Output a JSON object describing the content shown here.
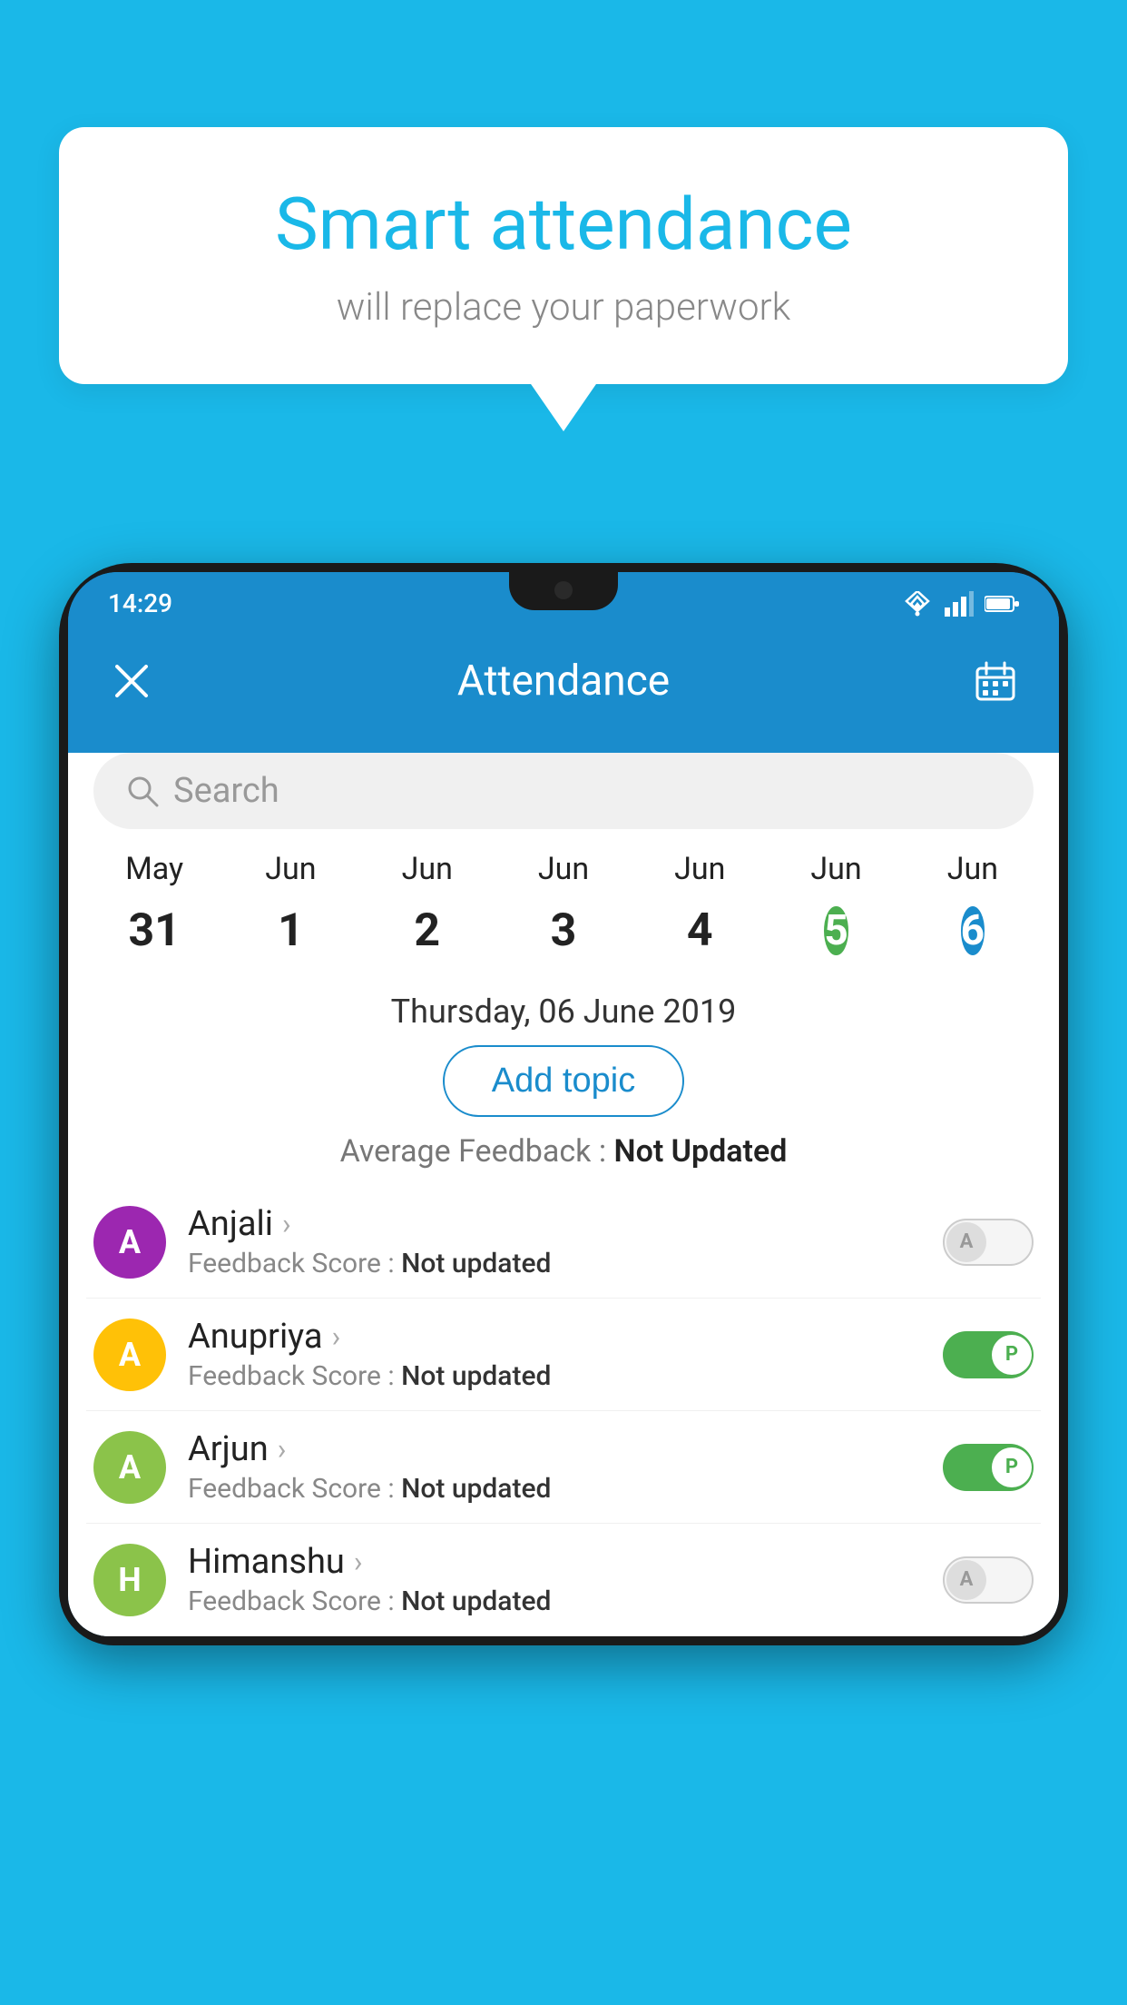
{
  "background_color": "#1ab8e8",
  "speech_bubble": {
    "title": "Smart attendance",
    "subtitle": "will replace your paperwork"
  },
  "status_bar": {
    "time": "14:29",
    "icons": [
      "wifi",
      "signal",
      "battery"
    ]
  },
  "app_header": {
    "title": "Attendance",
    "close_icon": "×",
    "calendar_icon": "📅"
  },
  "search": {
    "placeholder": "Search"
  },
  "calendar": {
    "months": [
      "May",
      "Jun",
      "Jun",
      "Jun",
      "Jun",
      "Jun",
      "Jun"
    ],
    "dates": [
      "31",
      "1",
      "2",
      "3",
      "4",
      "5",
      "6"
    ],
    "today_index": 5,
    "selected_index": 6
  },
  "selected_date_label": "Thursday, 06 June 2019",
  "add_topic_label": "Add topic",
  "avg_feedback": {
    "label": "Average Feedback :",
    "value": "Not Updated"
  },
  "students": [
    {
      "name": "Anjali",
      "avatar_letter": "A",
      "avatar_color": "#9c27b0",
      "feedback_label": "Feedback Score :",
      "feedback_value": "Not updated",
      "toggle": "off",
      "toggle_letter": "A"
    },
    {
      "name": "Anupriya",
      "avatar_letter": "A",
      "avatar_color": "#ffc107",
      "feedback_label": "Feedback Score :",
      "feedback_value": "Not updated",
      "toggle": "on",
      "toggle_letter": "P"
    },
    {
      "name": "Arjun",
      "avatar_letter": "A",
      "avatar_color": "#8bc34a",
      "feedback_label": "Feedback Score :",
      "feedback_value": "Not updated",
      "toggle": "on",
      "toggle_letter": "P"
    },
    {
      "name": "Himanshu",
      "avatar_letter": "H",
      "avatar_color": "#8bc34a",
      "feedback_label": "Feedback Score :",
      "feedback_value": "Not updated",
      "toggle": "off",
      "toggle_letter": "A"
    }
  ]
}
